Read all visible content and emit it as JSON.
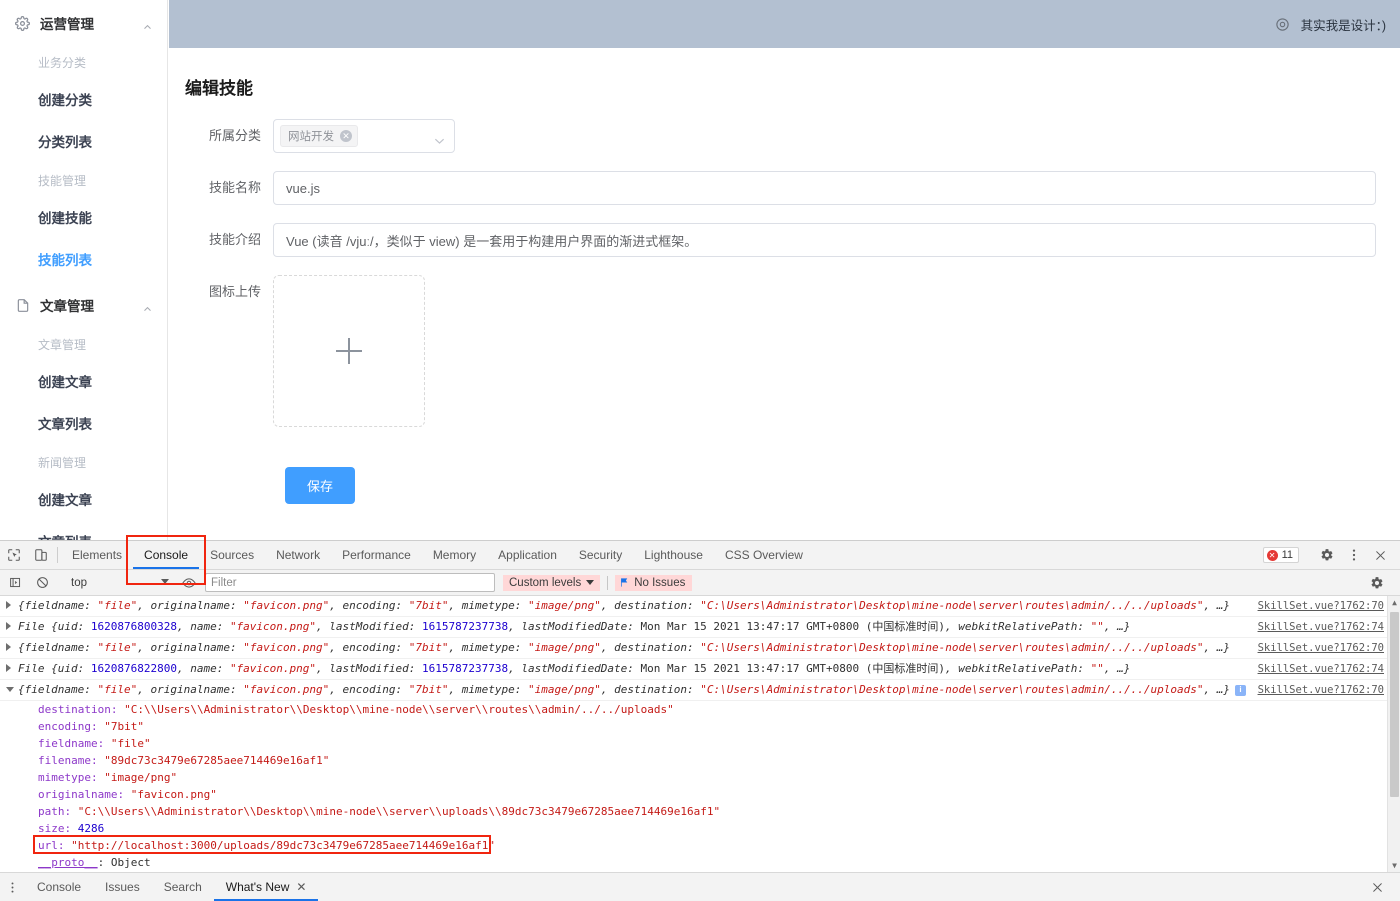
{
  "app": {
    "header": {
      "user_label": "其实我是设计：)",
      "avatar_icon": "gear-avatar-icon",
      "bg_color": "#b3c0d1"
    },
    "sidebar": {
      "groups": [
        {
          "icon": "gear-icon",
          "title": "运营管理",
          "collapse_icon": "chevron-up-icon",
          "sections": [
            {
              "title": "业务分类",
              "items": [
                "创建分类",
                "分类列表"
              ]
            },
            {
              "title": "技能管理",
              "items": [
                "创建技能",
                "技能列表"
              ]
            }
          ],
          "active_item": "技能列表"
        },
        {
          "icon": "document-icon",
          "title": "文章管理",
          "collapse_icon": "chevron-up-icon",
          "sections": [
            {
              "title": "文章管理",
              "items": [
                "创建文章",
                "文章列表"
              ]
            },
            {
              "title": "新闻管理",
              "items": [
                "创建文章",
                "文章列表"
              ]
            }
          ],
          "active_item": ""
        }
      ]
    },
    "form": {
      "title": "编辑技能",
      "fields": {
        "category_label": "所属分类",
        "category_tag": "网站开发",
        "category_caret_icon": "chevron-down-icon",
        "name_label": "技能名称",
        "name_value": "vue.js",
        "intro_label": "技能介绍",
        "intro_value": "Vue (读音 /vjuː/，类似于 view) 是一套用于构建用户界面的渐进式框架。",
        "upload_label": "图标上传",
        "upload_plus_icon": "plus-icon"
      },
      "save_label": "保存",
      "save_color": "#409eff"
    }
  },
  "devtools": {
    "toolbar": {
      "inspect_icon": "inspect-element-icon",
      "device_icon": "device-toolbar-icon",
      "tabs": [
        "Elements",
        "Console",
        "Sources",
        "Network",
        "Performance",
        "Memory",
        "Application",
        "Security",
        "Lighthouse",
        "CSS Overview"
      ],
      "active_tab": "Console",
      "error_count": "11",
      "error_icon": "error-circle-icon",
      "settings_icon": "gear-icon",
      "more_icon": "kebab-menu-icon",
      "close_icon": "close-icon"
    },
    "filterbar": {
      "execute_icon": "execute-step-icon",
      "clear_icon": "clear-console-icon",
      "context": "top",
      "eye_icon": "live-expression-eye-icon",
      "filter_placeholder": "Filter",
      "filter_value": "",
      "levels_label": "Custom levels",
      "levels_caret_icon": "caret-down-icon",
      "issues_label": "No Issues",
      "issues_icon": "issues-flag-icon",
      "settings_icon": "gear-icon"
    },
    "console": {
      "logs": [
        {
          "expanded": false,
          "source": "SkillSet.vue?1762:70",
          "parts": [
            {
              "t": "{fieldname: ",
              "c": "summary"
            },
            {
              "t": "\"file\"",
              "c": "s"
            },
            {
              "t": ", originalname: ",
              "c": "summary"
            },
            {
              "t": "\"favicon.png\"",
              "c": "s"
            },
            {
              "t": ", encoding: ",
              "c": "summary"
            },
            {
              "t": "\"7bit\"",
              "c": "s"
            },
            {
              "t": ", mimetype: ",
              "c": "summary"
            },
            {
              "t": "\"image/png\"",
              "c": "s"
            },
            {
              "t": ", destination: ",
              "c": "summary"
            },
            {
              "t": "\"C:\\Users\\Administrator\\Desktop\\mine-node\\server\\routes\\admin/../../uploads\"",
              "c": "s"
            },
            {
              "t": ", …}",
              "c": "summary"
            }
          ]
        },
        {
          "expanded": false,
          "source": "SkillSet.vue?1762:74",
          "parts": [
            {
              "t": "File {uid: ",
              "c": "summary"
            },
            {
              "t": "1620876800328",
              "c": "n"
            },
            {
              "t": ", name: ",
              "c": "summary"
            },
            {
              "t": "\"favicon.png\"",
              "c": "s"
            },
            {
              "t": ", lastModified: ",
              "c": "summary"
            },
            {
              "t": "1615787237738",
              "c": "n"
            },
            {
              "t": ", lastModifiedDate: ",
              "c": "summary"
            },
            {
              "t": "Mon Mar 15 2021 13:47:17 GMT+0800 (中国标准时间)",
              "c": "plain"
            },
            {
              "t": ", webkitRelativePath: ",
              "c": "summary"
            },
            {
              "t": "\"\"",
              "c": "s"
            },
            {
              "t": ", …}",
              "c": "summary"
            }
          ]
        },
        {
          "expanded": false,
          "source": "SkillSet.vue?1762:70",
          "parts": [
            {
              "t": "{fieldname: ",
              "c": "summary"
            },
            {
              "t": "\"file\"",
              "c": "s"
            },
            {
              "t": ", originalname: ",
              "c": "summary"
            },
            {
              "t": "\"favicon.png\"",
              "c": "s"
            },
            {
              "t": ", encoding: ",
              "c": "summary"
            },
            {
              "t": "\"7bit\"",
              "c": "s"
            },
            {
              "t": ", mimetype: ",
              "c": "summary"
            },
            {
              "t": "\"image/png\"",
              "c": "s"
            },
            {
              "t": ", destination: ",
              "c": "summary"
            },
            {
              "t": "\"C:\\Users\\Administrator\\Desktop\\mine-node\\server\\routes\\admin/../../uploads\"",
              "c": "s"
            },
            {
              "t": ", …}",
              "c": "summary"
            }
          ]
        },
        {
          "expanded": false,
          "source": "SkillSet.vue?1762:74",
          "parts": [
            {
              "t": "File {uid: ",
              "c": "summary"
            },
            {
              "t": "1620876822800",
              "c": "n"
            },
            {
              "t": ", name: ",
              "c": "summary"
            },
            {
              "t": "\"favicon.png\"",
              "c": "s"
            },
            {
              "t": ", lastModified: ",
              "c": "summary"
            },
            {
              "t": "1615787237738",
              "c": "n"
            },
            {
              "t": ", lastModifiedDate: ",
              "c": "summary"
            },
            {
              "t": "Mon Mar 15 2021 13:47:17 GMT+0800 (中国标准时间)",
              "c": "plain"
            },
            {
              "t": ", webkitRelativePath: ",
              "c": "summary"
            },
            {
              "t": "\"\"",
              "c": "s"
            },
            {
              "t": ", …}",
              "c": "summary"
            }
          ]
        },
        {
          "expanded": true,
          "source": "SkillSet.vue?1762:70",
          "info_badge": "i",
          "parts": [
            {
              "t": "{fieldname: ",
              "c": "summary"
            },
            {
              "t": "\"file\"",
              "c": "s"
            },
            {
              "t": ", originalname: ",
              "c": "summary"
            },
            {
              "t": "\"favicon.png\"",
              "c": "s"
            },
            {
              "t": ", encoding: ",
              "c": "summary"
            },
            {
              "t": "\"7bit\"",
              "c": "s"
            },
            {
              "t": ", mimetype: ",
              "c": "summary"
            },
            {
              "t": "\"image/png\"",
              "c": "s"
            },
            {
              "t": ", destination: ",
              "c": "summary"
            },
            {
              "t": "\"C:\\Users\\Administrator\\Desktop\\mine-node\\server\\routes\\admin/../../uploads\"",
              "c": "s"
            },
            {
              "t": ", …}",
              "c": "summary"
            }
          ],
          "properties": [
            {
              "key": "destination",
              "value": "\"C:\\\\Users\\\\Administrator\\\\Desktop\\\\mine-node\\\\server\\\\routes\\\\admin/../../uploads\"",
              "type": "string"
            },
            {
              "key": "encoding",
              "value": "\"7bit\"",
              "type": "string"
            },
            {
              "key": "fieldname",
              "value": "\"file\"",
              "type": "string"
            },
            {
              "key": "filename",
              "value": "\"89dc73c3479e67285aee714469e16af1\"",
              "type": "string"
            },
            {
              "key": "mimetype",
              "value": "\"image/png\"",
              "type": "string"
            },
            {
              "key": "originalname",
              "value": "\"favicon.png\"",
              "type": "string"
            },
            {
              "key": "path",
              "value": "\"C:\\\\Users\\\\Administrator\\\\Desktop\\\\mine-node\\\\server\\\\uploads\\\\89dc73c3479e67285aee714469e16af1\"",
              "type": "string"
            },
            {
              "key": "size",
              "value": "4286",
              "type": "number"
            },
            {
              "key": "url",
              "value": "\"http://localhost:3000/uploads/89dc73c3479e67285aee714469e16af1\"",
              "type": "string",
              "highlighted": true
            }
          ],
          "proto_key": "__proto__",
          "proto_value": "Object"
        }
      ],
      "prompt_symbol": ">"
    },
    "drawer": {
      "menu_icon": "kebab-menu-icon",
      "tabs": [
        "Console",
        "Issues",
        "Search",
        "What's New"
      ],
      "active_tab": "What's New",
      "close_tab_icon": "close-icon",
      "close_drawer_icon": "close-icon"
    },
    "highlight_color": "#f0250f"
  }
}
